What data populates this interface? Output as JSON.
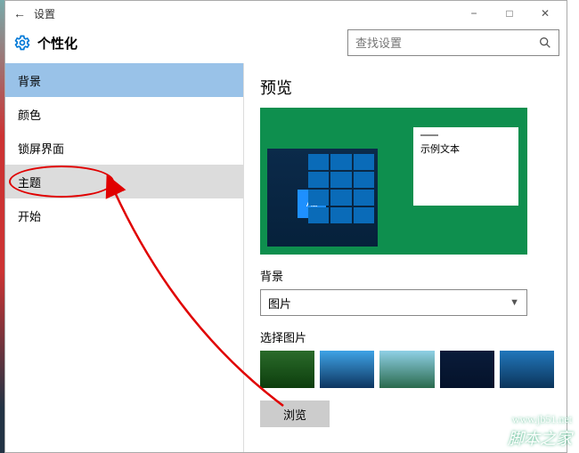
{
  "titlebar": {
    "title": "设置"
  },
  "header": {
    "section": "个性化"
  },
  "search": {
    "placeholder": "查找设置"
  },
  "sidebar": {
    "items": [
      {
        "label": "背景",
        "state": "active"
      },
      {
        "label": "颜色",
        "state": ""
      },
      {
        "label": "锁屏界面",
        "state": ""
      },
      {
        "label": "主题",
        "state": "hover"
      },
      {
        "label": "开始",
        "state": ""
      }
    ]
  },
  "main": {
    "preview_title": "预览",
    "preview_sample_text": "示例文本",
    "preview_tile_text": "Aa",
    "background_label": "背景",
    "background_value": "图片",
    "choose_picture_label": "选择图片",
    "browse_label": "浏览"
  },
  "watermark": {
    "text": "脚本之家",
    "url": "www.jb51.net"
  }
}
